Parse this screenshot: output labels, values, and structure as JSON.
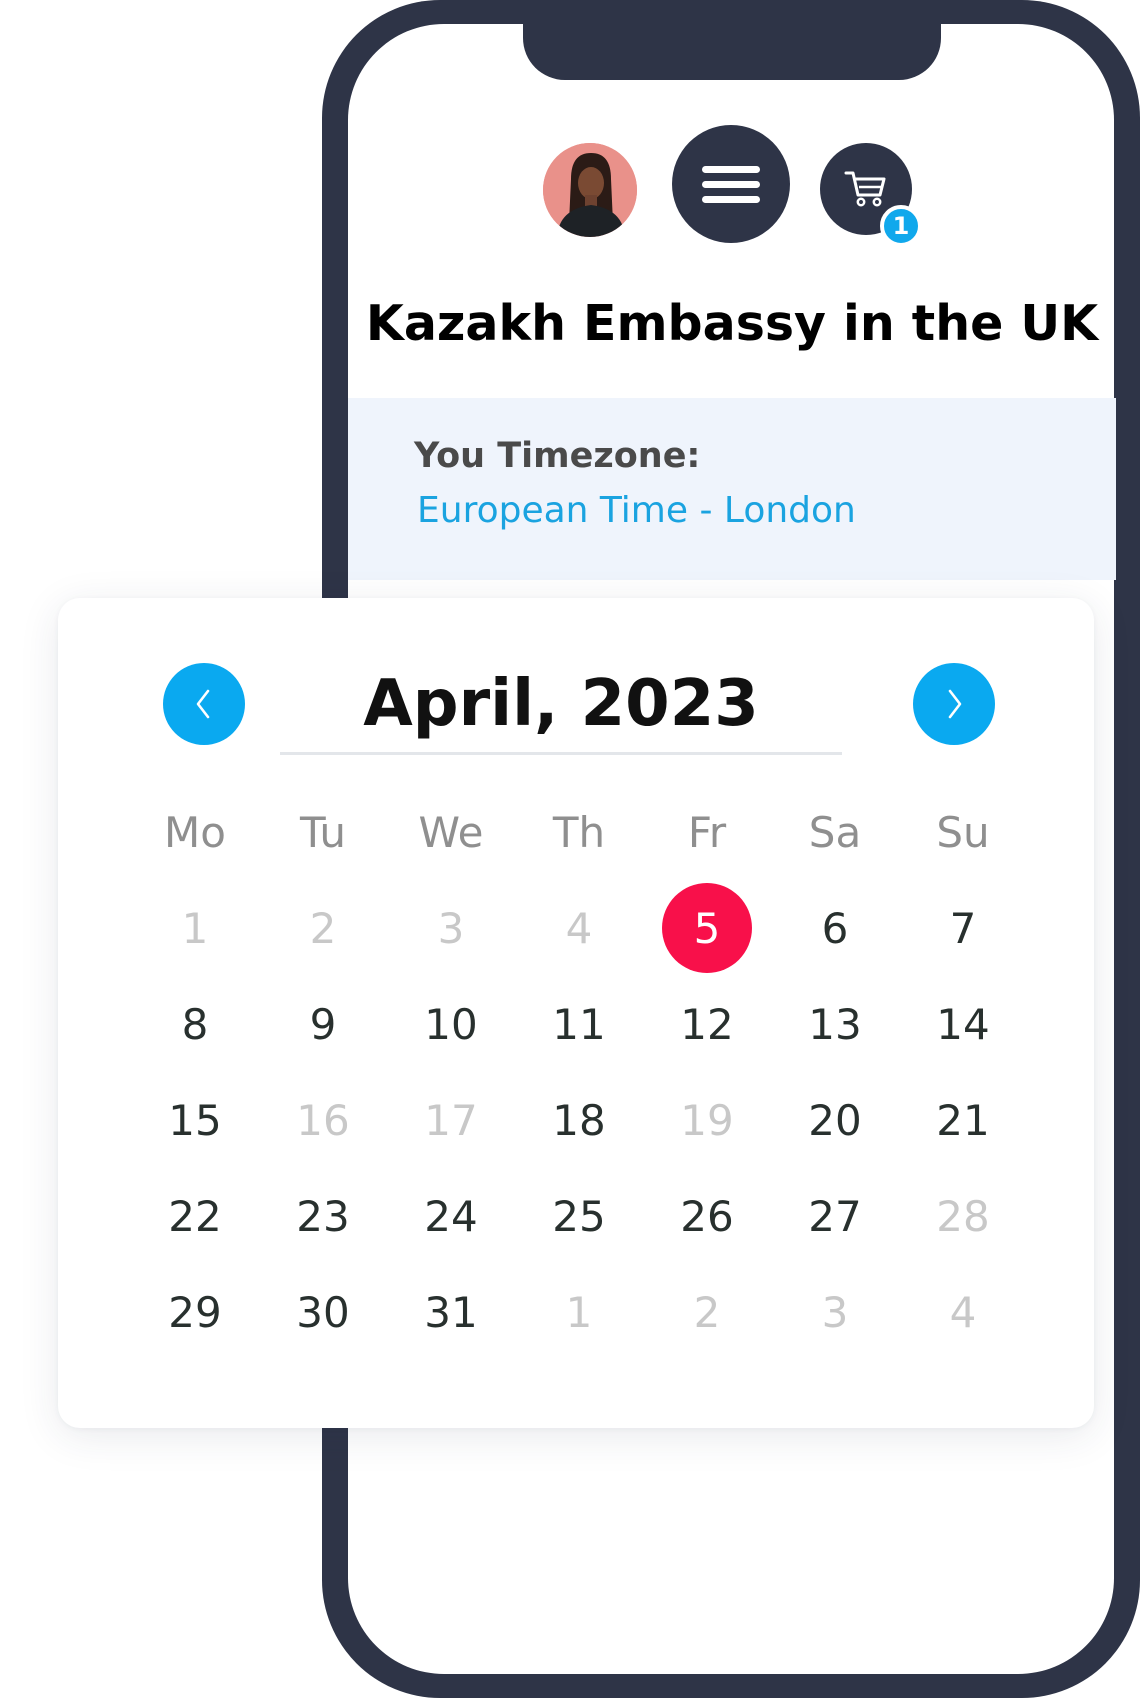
{
  "header": {
    "avatar_alt": "user avatar",
    "cart_count": "1"
  },
  "page": {
    "title": "Kazakh Embassy in the UK"
  },
  "timezone": {
    "label": "You Timezone:",
    "value": "European Time - London"
  },
  "calendar": {
    "month_label": "April, 2023",
    "weekdays": [
      "Mo",
      "Tu",
      "We",
      "Th",
      "Fr",
      "Sa",
      "Su"
    ],
    "days": [
      {
        "n": "1",
        "state": "muted"
      },
      {
        "n": "2",
        "state": "muted"
      },
      {
        "n": "3",
        "state": "muted"
      },
      {
        "n": "4",
        "state": "muted"
      },
      {
        "n": "5",
        "state": "selected"
      },
      {
        "n": "6",
        "state": "available"
      },
      {
        "n": "7",
        "state": "available"
      },
      {
        "n": "8",
        "state": "available"
      },
      {
        "n": "9",
        "state": "available"
      },
      {
        "n": "10",
        "state": "available"
      },
      {
        "n": "11",
        "state": "available"
      },
      {
        "n": "12",
        "state": "available"
      },
      {
        "n": "13",
        "state": "available"
      },
      {
        "n": "14",
        "state": "available"
      },
      {
        "n": "15",
        "state": "available"
      },
      {
        "n": "16",
        "state": "muted"
      },
      {
        "n": "17",
        "state": "muted"
      },
      {
        "n": "18",
        "state": "available"
      },
      {
        "n": "19",
        "state": "muted"
      },
      {
        "n": "20",
        "state": "available"
      },
      {
        "n": "21",
        "state": "available"
      },
      {
        "n": "22",
        "state": "available"
      },
      {
        "n": "23",
        "state": "available"
      },
      {
        "n": "24",
        "state": "available"
      },
      {
        "n": "25",
        "state": "available"
      },
      {
        "n": "26",
        "state": "available"
      },
      {
        "n": "27",
        "state": "available"
      },
      {
        "n": "28",
        "state": "muted"
      },
      {
        "n": "29",
        "state": "available"
      },
      {
        "n": "30",
        "state": "available"
      },
      {
        "n": "31",
        "state": "available"
      },
      {
        "n": "1",
        "state": "muted"
      },
      {
        "n": "2",
        "state": "muted"
      },
      {
        "n": "3",
        "state": "muted"
      },
      {
        "n": "4",
        "state": "muted"
      }
    ]
  },
  "icons": {
    "menu": "hamburger-menu-icon",
    "cart": "shopping-cart-icon",
    "prev": "chevron-left-icon",
    "next": "chevron-right-icon"
  },
  "colors": {
    "frame": "#2e3447",
    "accent_blue": "#0aa9f0",
    "selected_red": "#f8104a",
    "timezone_band": "#eff4fc",
    "timezone_link": "#1aa3e0"
  }
}
